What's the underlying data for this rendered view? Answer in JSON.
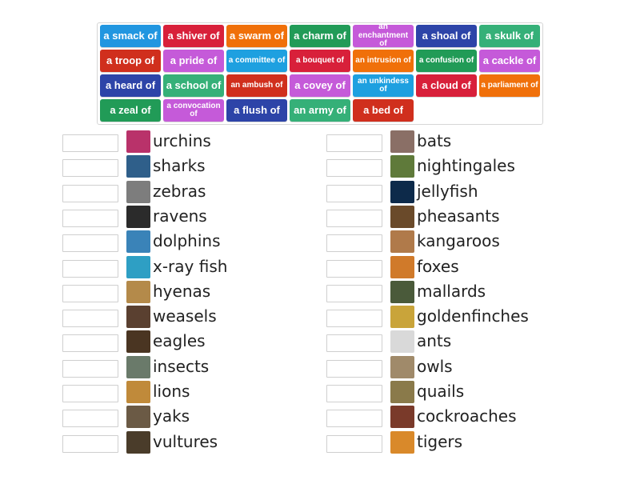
{
  "colors": {
    "blue": "#2196e0",
    "red": "#d8203a",
    "orange": "#f0700a",
    "green": "#219b57",
    "purple": "#c55ad9",
    "navy": "#2d44a8",
    "teal": "#35b078",
    "sky": "#1ea0e0",
    "deep_red": "#d02f1d"
  },
  "tiles": [
    {
      "label": "a smack of",
      "color": "blue",
      "size": "big"
    },
    {
      "label": "a shiver of",
      "color": "red",
      "size": "big"
    },
    {
      "label": "a swarm of",
      "color": "orange",
      "size": "big"
    },
    {
      "label": "a charm of",
      "color": "green",
      "size": "big"
    },
    {
      "label": "an enchantment of",
      "color": "purple",
      "size": "small"
    },
    {
      "label": "a shoal of",
      "color": "navy",
      "size": "big"
    },
    {
      "label": "a skulk of",
      "color": "teal",
      "size": "big"
    },
    {
      "label": "a troop of",
      "color": "deep_red",
      "size": "big"
    },
    {
      "label": "a pride of",
      "color": "purple",
      "size": "big"
    },
    {
      "label": "a committee of",
      "color": "sky",
      "size": "small"
    },
    {
      "label": "a bouquet of",
      "color": "red",
      "size": "small"
    },
    {
      "label": "an intrusion of",
      "color": "orange",
      "size": "small"
    },
    {
      "label": "a confusion of",
      "color": "green",
      "size": "small"
    },
    {
      "label": "a cackle of",
      "color": "purple",
      "size": "big"
    },
    {
      "label": "a heard of",
      "color": "navy",
      "size": "big"
    },
    {
      "label": "a school of",
      "color": "teal",
      "size": "big"
    },
    {
      "label": "an ambush of",
      "color": "deep_red",
      "size": "small"
    },
    {
      "label": "a covey of",
      "color": "purple",
      "size": "big"
    },
    {
      "label": "an unkindess of",
      "color": "sky",
      "size": "small"
    },
    {
      "label": "a cloud of",
      "color": "red",
      "size": "big"
    },
    {
      "label": "a parliament of",
      "color": "orange",
      "size": "small"
    },
    {
      "label": "a zeal of",
      "color": "green",
      "size": "big"
    },
    {
      "label": "a convocation of",
      "color": "purple",
      "size": "small"
    },
    {
      "label": "a flush of",
      "color": "navy",
      "size": "big"
    },
    {
      "label": "an army of",
      "color": "teal",
      "size": "big"
    },
    {
      "label": "a bed of",
      "color": "deep_red",
      "size": "big"
    }
  ],
  "left_items": [
    {
      "word": "urchins",
      "img": "urchin-image",
      "bg": "#b9326a"
    },
    {
      "word": "sharks",
      "img": "shark-image",
      "bg": "#2f5f8a"
    },
    {
      "word": "zebras",
      "img": "zebra-image",
      "bg": "#7d7d7d"
    },
    {
      "word": "ravens",
      "img": "raven-image",
      "bg": "#2b2b2b"
    },
    {
      "word": "dolphins",
      "img": "dolphin-image",
      "bg": "#3a83b8"
    },
    {
      "word": "x-ray fish",
      "img": "xray-fish-image",
      "bg": "#2e9fc4"
    },
    {
      "word": "hyenas",
      "img": "hyena-image",
      "bg": "#b48a4a"
    },
    {
      "word": "weasels",
      "img": "weasel-image",
      "bg": "#5a4030"
    },
    {
      "word": "eagles",
      "img": "eagle-image",
      "bg": "#4a3522"
    },
    {
      "word": "insects",
      "img": "insect-image",
      "bg": "#6a7a6a"
    },
    {
      "word": "lions",
      "img": "lion-image",
      "bg": "#c08a3a"
    },
    {
      "word": "yaks",
      "img": "yak-image",
      "bg": "#6b5a45"
    },
    {
      "word": "vultures",
      "img": "vulture-image",
      "bg": "#4a3c2a"
    }
  ],
  "right_items": [
    {
      "word": "bats",
      "img": "bat-image",
      "bg": "#8a6f66"
    },
    {
      "word": "nightingales",
      "img": "nightingale-image",
      "bg": "#5f7a3a"
    },
    {
      "word": "jellyfish",
      "img": "jellyfish-image",
      "bg": "#0d2a4a"
    },
    {
      "word": "pheasants",
      "img": "pheasant-image",
      "bg": "#6a4a2a"
    },
    {
      "word": "kangaroos",
      "img": "kangaroo-image",
      "bg": "#b07a4a"
    },
    {
      "word": "foxes",
      "img": "fox-image",
      "bg": "#d07a2a"
    },
    {
      "word": "mallards",
      "img": "mallard-image",
      "bg": "#4a5a3a"
    },
    {
      "word": "goldenfinches",
      "img": "goldfinch-image",
      "bg": "#c9a43a"
    },
    {
      "word": "ants",
      "img": "ant-image",
      "bg": "#d9d9d9"
    },
    {
      "word": "owls",
      "img": "owl-image",
      "bg": "#a08a6a"
    },
    {
      "word": "quails",
      "img": "quail-image",
      "bg": "#8a7a4a"
    },
    {
      "word": "cockroaches",
      "img": "cockroach-image",
      "bg": "#7a3a2a"
    },
    {
      "word": "tigers",
      "img": "tiger-image",
      "bg": "#d9892a"
    }
  ]
}
